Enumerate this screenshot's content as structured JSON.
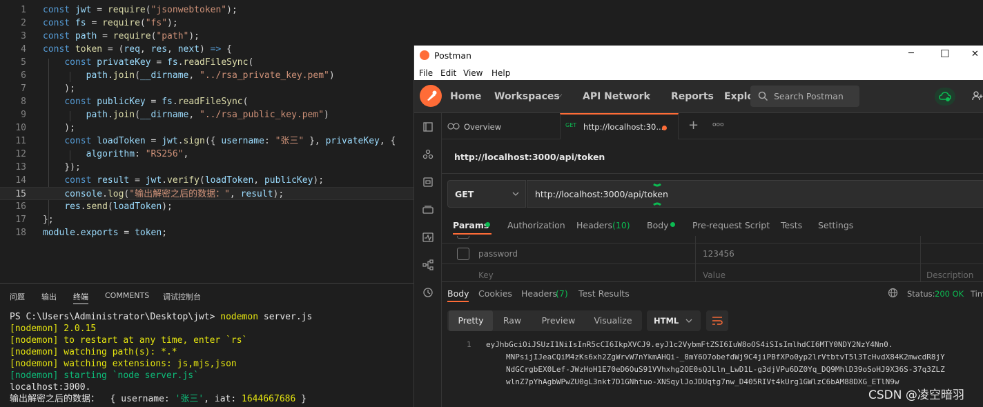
{
  "editor": {
    "lines": [
      {
        "n": "1",
        "tokens": [
          [
            "kw",
            "const "
          ],
          [
            "var",
            "jwt"
          ],
          [
            "pl",
            " = "
          ],
          [
            "fn",
            "require"
          ],
          [
            "pl",
            "("
          ],
          [
            "str",
            "\"jsonwebtoken\""
          ],
          [
            "pl",
            ");"
          ]
        ]
      },
      {
        "n": "2",
        "tokens": [
          [
            "kw",
            "const "
          ],
          [
            "var",
            "fs"
          ],
          [
            "pl",
            " = "
          ],
          [
            "fn",
            "require"
          ],
          [
            "pl",
            "("
          ],
          [
            "str",
            "\"fs\""
          ],
          [
            "pl",
            ");"
          ]
        ]
      },
      {
        "n": "3",
        "tokens": [
          [
            "kw",
            "const "
          ],
          [
            "var",
            "path"
          ],
          [
            "pl",
            " = "
          ],
          [
            "fn",
            "require"
          ],
          [
            "pl",
            "("
          ],
          [
            "str",
            "\"path\""
          ],
          [
            "pl",
            ");"
          ]
        ]
      },
      {
        "n": "4",
        "tokens": [
          [
            "kw",
            "const "
          ],
          [
            "fn",
            "token"
          ],
          [
            "pl",
            " = ("
          ],
          [
            "var",
            "req"
          ],
          [
            "pl",
            ", "
          ],
          [
            "var",
            "res"
          ],
          [
            "pl",
            ", "
          ],
          [
            "var",
            "next"
          ],
          [
            "pl",
            ") "
          ],
          [
            "kw",
            "=>"
          ],
          [
            "pl",
            " {"
          ]
        ]
      },
      {
        "n": "5",
        "tokens": [
          [
            "pl",
            "    "
          ],
          [
            "kw",
            "const "
          ],
          [
            "var",
            "privateKey"
          ],
          [
            "pl",
            " = "
          ],
          [
            "var",
            "fs"
          ],
          [
            "pl",
            "."
          ],
          [
            "fn",
            "readFileSync"
          ],
          [
            "pl",
            "("
          ]
        ]
      },
      {
        "n": "6",
        "tokens": [
          [
            "pl",
            "        "
          ],
          [
            "var",
            "path"
          ],
          [
            "pl",
            "."
          ],
          [
            "fn",
            "join"
          ],
          [
            "pl",
            "("
          ],
          [
            "var",
            "__dirname"
          ],
          [
            "pl",
            ", "
          ],
          [
            "str",
            "\"../rsa_private_key.pem\""
          ],
          [
            "pl",
            ")"
          ]
        ]
      },
      {
        "n": "7",
        "tokens": [
          [
            "pl",
            "    );"
          ]
        ]
      },
      {
        "n": "8",
        "tokens": [
          [
            "pl",
            "    "
          ],
          [
            "kw",
            "const "
          ],
          [
            "var",
            "publicKey"
          ],
          [
            "pl",
            " = "
          ],
          [
            "var",
            "fs"
          ],
          [
            "pl",
            "."
          ],
          [
            "fn",
            "readFileSync"
          ],
          [
            "pl",
            "("
          ]
        ]
      },
      {
        "n": "9",
        "tokens": [
          [
            "pl",
            "        "
          ],
          [
            "var",
            "path"
          ],
          [
            "pl",
            "."
          ],
          [
            "fn",
            "join"
          ],
          [
            "pl",
            "("
          ],
          [
            "var",
            "__dirname"
          ],
          [
            "pl",
            ", "
          ],
          [
            "str",
            "\"../rsa_public_key.pem\""
          ],
          [
            "pl",
            ")"
          ]
        ]
      },
      {
        "n": "10",
        "tokens": [
          [
            "pl",
            "    );"
          ]
        ]
      },
      {
        "n": "11",
        "tokens": [
          [
            "pl",
            "    "
          ],
          [
            "kw",
            "const "
          ],
          [
            "var",
            "loadToken"
          ],
          [
            "pl",
            " = "
          ],
          [
            "var",
            "jwt"
          ],
          [
            "pl",
            "."
          ],
          [
            "fn",
            "sign"
          ],
          [
            "pl",
            "({ "
          ],
          [
            "var",
            "username"
          ],
          [
            "pl",
            ": "
          ],
          [
            "str",
            "\"张三\""
          ],
          [
            "pl",
            " }, "
          ],
          [
            "var",
            "privateKey"
          ],
          [
            "pl",
            ", {"
          ]
        ]
      },
      {
        "n": "12",
        "tokens": [
          [
            "pl",
            "        "
          ],
          [
            "var",
            "algorithm"
          ],
          [
            "pl",
            ": "
          ],
          [
            "str",
            "\"RS256\""
          ],
          [
            "pl",
            ","
          ]
        ]
      },
      {
        "n": "13",
        "tokens": [
          [
            "pl",
            "    });"
          ]
        ]
      },
      {
        "n": "14",
        "tokens": [
          [
            "pl",
            "    "
          ],
          [
            "kw",
            "const "
          ],
          [
            "var",
            "result"
          ],
          [
            "pl",
            " = "
          ],
          [
            "var",
            "jwt"
          ],
          [
            "pl",
            "."
          ],
          [
            "fn",
            "verify"
          ],
          [
            "pl",
            "("
          ],
          [
            "var",
            "loadToken"
          ],
          [
            "pl",
            ", "
          ],
          [
            "var",
            "publicKey"
          ],
          [
            "pl",
            ");"
          ]
        ]
      },
      {
        "n": "15",
        "tokens": [
          [
            "pl",
            "    "
          ],
          [
            "var",
            "console"
          ],
          [
            "pl",
            "."
          ],
          [
            "fn",
            "log"
          ],
          [
            "pl",
            "("
          ],
          [
            "str",
            "\"输出解密之后的数据："
          ],
          [
            "str",
            "\""
          ],
          [
            "pl",
            ", "
          ],
          [
            "var",
            "result"
          ],
          [
            "pl",
            ");"
          ]
        ]
      },
      {
        "n": "16",
        "tokens": [
          [
            "pl",
            "    "
          ],
          [
            "var",
            "res"
          ],
          [
            "pl",
            "."
          ],
          [
            "fn",
            "send"
          ],
          [
            "pl",
            "("
          ],
          [
            "var",
            "loadToken"
          ],
          [
            "pl",
            ");"
          ]
        ]
      },
      {
        "n": "17",
        "tokens": [
          [
            "pl",
            "};"
          ]
        ]
      },
      {
        "n": "18",
        "tokens": [
          [
            "var",
            "module"
          ],
          [
            "pl",
            "."
          ],
          [
            "var",
            "exports"
          ],
          [
            "pl",
            " = "
          ],
          [
            "var",
            "token"
          ],
          [
            "pl",
            ";"
          ]
        ]
      }
    ],
    "current_line": 15
  },
  "panel": {
    "tabs": [
      "问题",
      "输出",
      "终端",
      "COMMENTS",
      "调试控制台"
    ],
    "active_tab": "终端",
    "terminal": {
      "prompt": "PS C:\\Users\\Administrator\\Desktop\\jwt>",
      "command": "nodemon",
      "command_arg": " server.js",
      "lines": [
        {
          "cls": "y",
          "text": "[nodemon] 2.0.15"
        },
        {
          "cls": "y",
          "text": "[nodemon] to restart at any time, enter `rs`"
        },
        {
          "cls": "y",
          "text": "[nodemon] watching path(s): *.*"
        },
        {
          "cls": "y",
          "text": "[nodemon] watching extensions: js,mjs,json"
        },
        {
          "cls": "g",
          "text": "[nodemon] starting `node server.js`"
        },
        {
          "cls": "tw",
          "text": "localhost:3000."
        }
      ],
      "output_prefix": "输出解密之后的数据：  { username: ",
      "output_name": "'张三'",
      "output_mid": ", iat: ",
      "output_iat": "1644667686",
      "output_end": " }"
    }
  },
  "postman": {
    "title": "Postman",
    "window_controls": {
      "minimize": "─",
      "maximize": "☐",
      "close": "✕"
    },
    "menu": [
      "File",
      "Edit",
      "View",
      "Help"
    ],
    "nav": [
      "Home",
      "Workspaces",
      "API Network",
      "Reports",
      "Explo"
    ],
    "search_placeholder": "Search Postman",
    "tabs": {
      "overview": "Overview",
      "request_method_badge": "GET",
      "request_title": "http://localhost:30...",
      "plus": "+",
      "more": "ooo"
    },
    "request_name": "http://localhost:3000/api/token",
    "method": "GET",
    "url": "http://localhost:3000/api/token",
    "request_tabs": [
      {
        "label": "Params",
        "active": true
      },
      {
        "label": "Authorization"
      },
      {
        "label": "Headers",
        "count": "(10)"
      },
      {
        "label": "Body"
      },
      {
        "label": "Pre-request Script"
      },
      {
        "label": "Tests"
      },
      {
        "label": "Settings"
      }
    ],
    "params": {
      "row_key": "password",
      "row_value": "123456",
      "header_key": "Key",
      "header_value": "Value",
      "header_description": "Description"
    },
    "response_tabs": {
      "body": "Body",
      "cookies": "Cookies",
      "headers": "Headers",
      "headers_count": "(7)",
      "tests": "Test Results"
    },
    "status_label": "Status:",
    "status_value": "200 OK",
    "time_label": "Tim",
    "view_buttons": [
      "Pretty",
      "Raw",
      "Preview",
      "Visualize"
    ],
    "format": "HTML",
    "body_line_number": "1",
    "token_lines": [
      "eyJhbGciOiJSUzI1NiIsInR5cCI6IkpXVCJ9.eyJ1c2VybmFtZSI6IuW8oOS4iSIsImlhdCI6MTY0NDY2NzY4Nn0.",
      "MNPsijIJeaCQiM4zKs6xh2ZgWrvW7nYkmAHQi-_8mY6O7obefdWj9C4jiPBfXPo0yp2lrVtbtvT5l3TcHvdX84K2mwcdR8jY",
      "NdGCrgbEX0Lef-JWzHoH1E70eD6OuS91VVhxhg2OE0sQJLln_LwD1L-g3djVPu6DZ0Yq_DQ9MhlD39oSoHJ9X36S-37q3ZLZ",
      "wlnZ7pYhAgbWPwZU0gL3nkt7D1GNhtuo-XNSqylJoJDUqtg7nw_D405RIVt4kUrg1GWlzC6bAM88DXG_ETlN9w"
    ]
  },
  "watermark": "CSDN @凌空暗羽",
  "colors": {
    "postman_orange": "#ff6c37",
    "status_green": "#0cbb52",
    "editor_bg": "#1e1e1e"
  }
}
